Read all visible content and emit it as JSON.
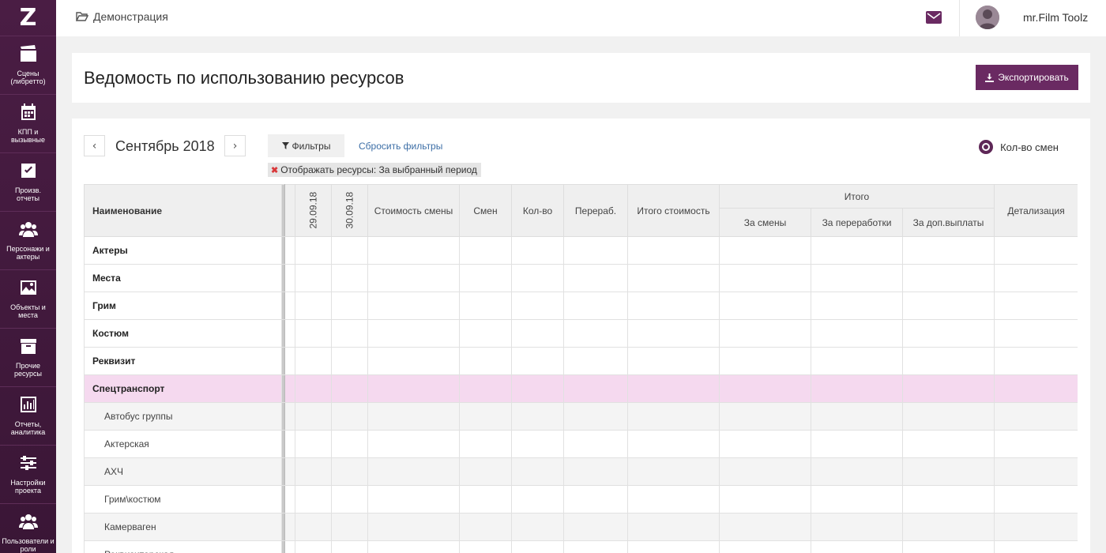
{
  "sidebar": {
    "logo": "Z",
    "items": [
      {
        "label": "Сцены\n(либретто)",
        "icon": "clapperboard-icon"
      },
      {
        "label": "КПП и\nвызывные",
        "icon": "calendar-icon"
      },
      {
        "label": "Произв.\nотчеты",
        "icon": "checkbox-icon"
      },
      {
        "label": "Персонажи и\nактеры",
        "icon": "users-icon"
      },
      {
        "label": "Объекты и\nместа",
        "icon": "image-icon"
      },
      {
        "label": "Прочие\nресурсы",
        "icon": "archive-icon"
      },
      {
        "label": "Отчеты,\nаналитика",
        "icon": "bar-chart-icon"
      },
      {
        "label": "Настройки\nпроекта",
        "icon": "sliders-icon"
      },
      {
        "label": "Пользователи и\nроли",
        "icon": "users-icon"
      }
    ]
  },
  "topbar": {
    "breadcrumb": "Демонстрация",
    "username": "mr.Film Toolz"
  },
  "page": {
    "title": "Ведомость по использованию ресурсов",
    "export_label": "Экспортировать"
  },
  "toolbar": {
    "prev": "‹",
    "next": "›",
    "month": "Сентябрь 2018",
    "filters_label": "Фильтры",
    "reset_label": "Сбросить фильтры",
    "chip_prefix": "Отображать ресурсы:",
    "chip_value": "За выбранный период",
    "radio_label": "Кол-во смен"
  },
  "table": {
    "headers": {
      "name": "Наименование",
      "date1": "29.09.18",
      "date2": "30.09.18",
      "cost": "Стоимость смены",
      "shifts": "Смен",
      "qty": "Кол-во",
      "overtime": "Перераб.",
      "total_cost": "Итого стоимость",
      "total": "Итого",
      "for_shifts": "За смены",
      "for_overtime": "За переработки",
      "for_extra": "За доп.выплаты",
      "details": "Детализация"
    },
    "rows": [
      {
        "name": "Актеры",
        "type": "group"
      },
      {
        "name": "Места",
        "type": "group"
      },
      {
        "name": "Грим",
        "type": "group"
      },
      {
        "name": "Костюм",
        "type": "group"
      },
      {
        "name": "Реквизит",
        "type": "group"
      },
      {
        "name": "Спецтранспорт",
        "type": "highlight"
      },
      {
        "name": "Автобус группы",
        "type": "sub-alt"
      },
      {
        "name": "Актерская",
        "type": "sub"
      },
      {
        "name": "АХЧ",
        "type": "sub-alt"
      },
      {
        "name": "Грим\\костюм",
        "type": "sub"
      },
      {
        "name": "Камерваген",
        "type": "sub-alt"
      },
      {
        "name": "Реквизиторская",
        "type": "sub"
      }
    ]
  },
  "colors": {
    "sidebar": "#4a1d44",
    "accent": "#6a2a62",
    "highlight_row": "#f5d9ef",
    "link": "#3c6ea6"
  }
}
